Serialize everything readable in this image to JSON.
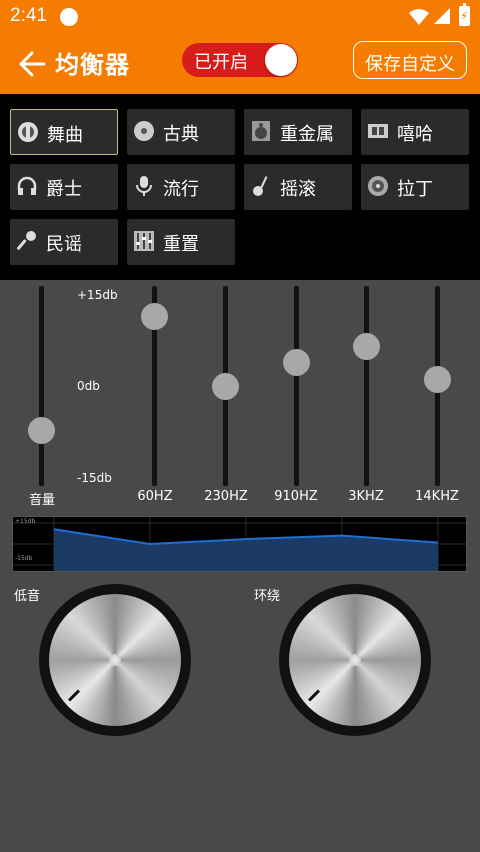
{
  "status": {
    "time": "2:41",
    "battery_glyph": "⚡"
  },
  "appbar": {
    "title": "均衡器",
    "toggle_label": "已开启",
    "save_label": "保存自定义"
  },
  "presets": [
    {
      "label": "舞曲",
      "icon": "disco-icon",
      "active": true
    },
    {
      "label": "古典",
      "icon": "cd-icon"
    },
    {
      "label": "重金属",
      "icon": "speaker-icon"
    },
    {
      "label": "嘻哈",
      "icon": "film-icon"
    },
    {
      "label": "爵士",
      "icon": "headphones-icon"
    },
    {
      "label": "流行",
      "icon": "microphone-icon"
    },
    {
      "label": "摇滚",
      "icon": "guitar-icon"
    },
    {
      "label": "拉丁",
      "icon": "record-icon"
    },
    {
      "label": "民谣",
      "icon": "handheld-mic-icon"
    },
    {
      "label": "重置",
      "icon": "mixer-icon"
    }
  ],
  "eq": {
    "db_max": "+15db",
    "db_mid": "0db",
    "db_min": "-15db",
    "volume": {
      "label": "音量",
      "level": 0.28
    },
    "bands": [
      {
        "label": "60HZ",
        "db": 10.5
      },
      {
        "label": "230HZ",
        "db": 0
      },
      {
        "label": "910HZ",
        "db": 3.5
      },
      {
        "label": "3KHZ",
        "db": 6
      },
      {
        "label": "14KHZ",
        "db": 1
      }
    ],
    "graph": {
      "top_label": "+15db",
      "bottom_label": "-15db"
    }
  },
  "knobs": {
    "bass_label": "低音",
    "surround_label": "环绕"
  },
  "colors": {
    "accent": "#f57c00",
    "toggle_on": "#d81b1b",
    "panel": "#494949",
    "graph_line": "#1e6fd1"
  }
}
